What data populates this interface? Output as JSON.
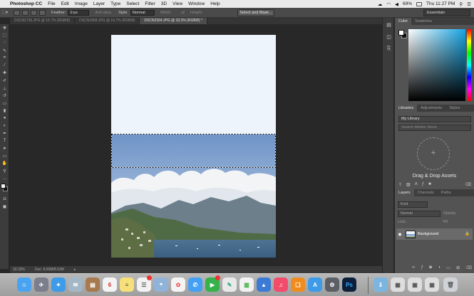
{
  "menubar": {
    "app_name": "Photoshop CC",
    "menus": [
      "File",
      "Edit",
      "Image",
      "Layer",
      "Type",
      "Select",
      "Filter",
      "3D",
      "View",
      "Window",
      "Help"
    ],
    "battery": "69%",
    "clock": "Thu 11:27 PM"
  },
  "options": {
    "feather_label": "Feather:",
    "feather_value": "0 px",
    "anti_alias_label": "Anti-alias",
    "style_label": "Style:",
    "style_value": "Normal",
    "width_label": "Width:",
    "height_label": "Height:",
    "select_mask_button": "Select and Mask...",
    "workspace": "Essentials"
  },
  "tabs": [
    {
      "label": "DSCN1726.JPG @ 16.7% (RGB/8)",
      "active": false
    },
    {
      "label": "DSCN1858.JPG @ 16.7% (RGB/8)",
      "active": false
    },
    {
      "label": "DSCN2364.JPG @ 33.3% (RGB/8) *",
      "active": true
    }
  ],
  "status": {
    "zoom": "33.33%",
    "doc": "Doc: 8.60M/8.63M"
  },
  "color_panel": {
    "tabs": [
      "Color",
      "Swatches"
    ],
    "hue_color": "#18a6e4"
  },
  "libraries_panel": {
    "tabs": [
      "Libraries",
      "Adjustments",
      "Styles"
    ],
    "library": "My Library",
    "search_placeholder": "Search Adobe Stock",
    "drop_label": "Drag & Drop Assets"
  },
  "layers_panel": {
    "tabs": [
      "Layers",
      "Channels",
      "Paths"
    ],
    "kind_filter": "Kind",
    "blend_mode": "Normal",
    "opacity_label": "Opacity:",
    "lock_label": "Lock:",
    "fill_label": "Fill:",
    "layer_name": "Background"
  }
}
